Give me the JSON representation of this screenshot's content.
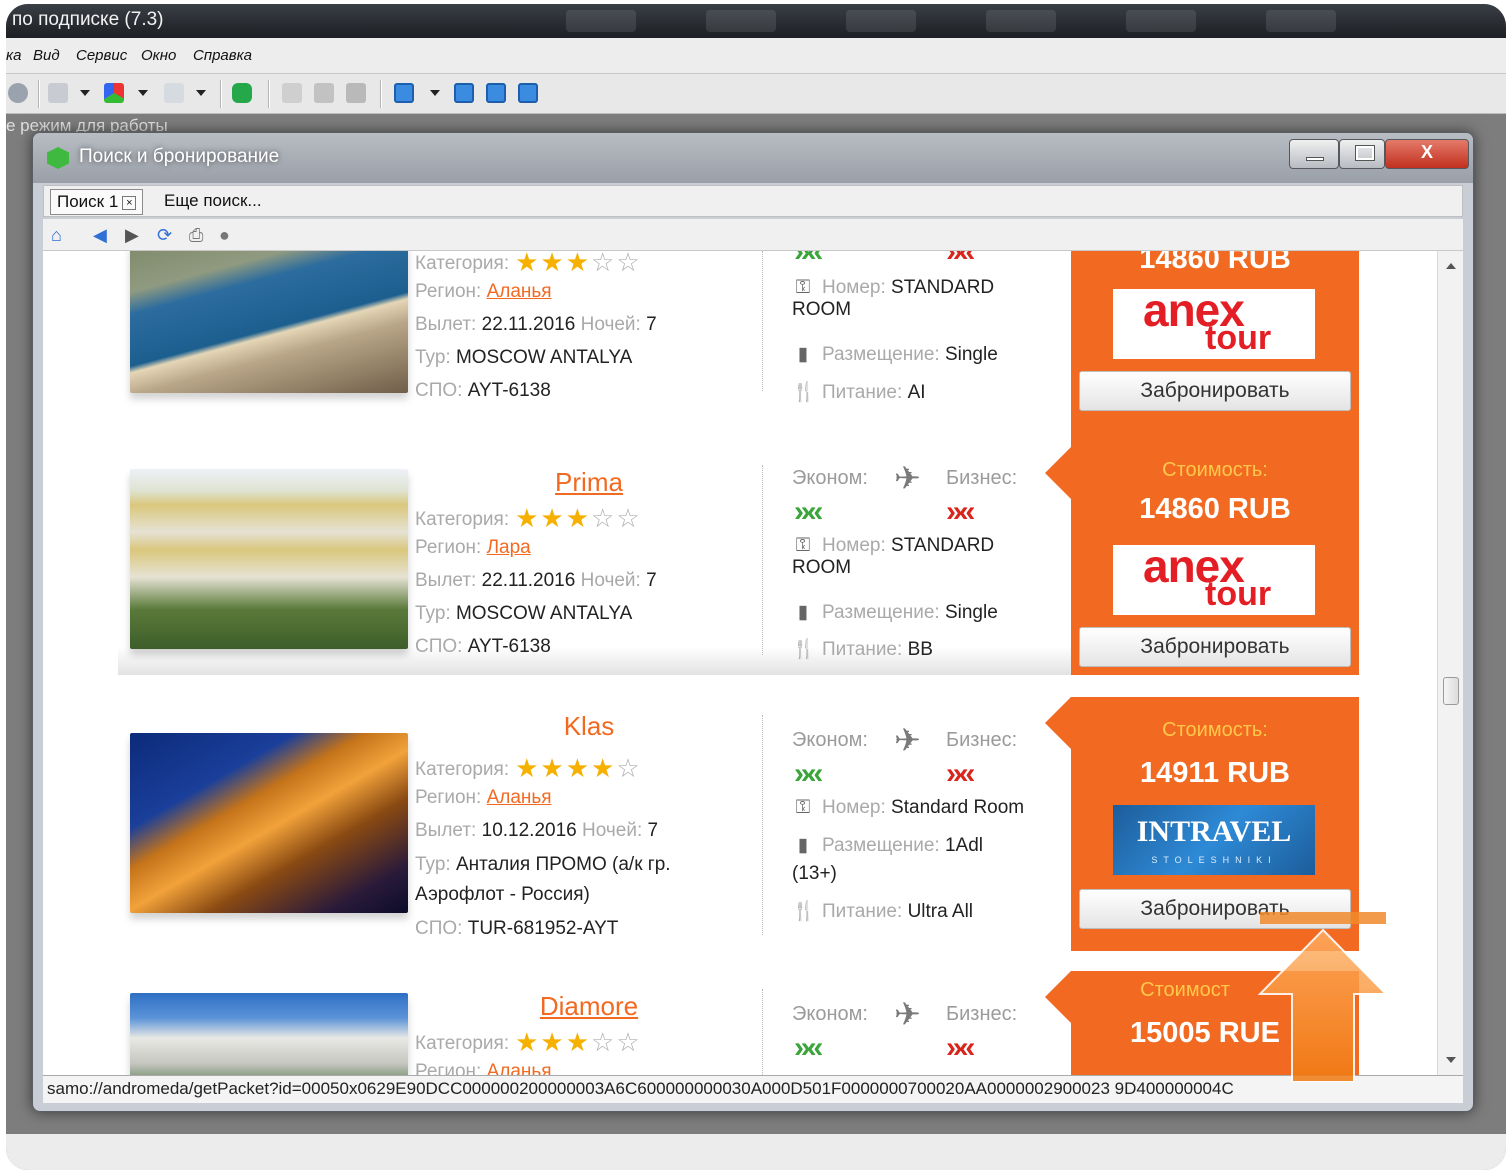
{
  "app": {
    "title_partial": "по подписке (7.3)",
    "menu": [
      "ка",
      "Вид",
      "Сервис",
      "Окно",
      "Справка"
    ],
    "status_partial": "е режим для работы"
  },
  "dialog": {
    "title": "Поиск и бронирование",
    "tabs": [
      {
        "label": "Поиск 1",
        "close": "×"
      },
      {
        "label": "Еще поиск..."
      }
    ],
    "window_buttons": {
      "minimize": "–",
      "maximize": "□",
      "close": "X"
    }
  },
  "labels": {
    "category": "Категория:",
    "region": "Регион:",
    "departure": "Вылет:",
    "nights": "Ночей:",
    "tour": "Тур:",
    "spo": "СПО:",
    "economy": "Эконом:",
    "business": "Бизнес:",
    "room": "Номер:",
    "placement": "Размещение:",
    "food": "Питание:",
    "cost": "Стоимость:",
    "book": "Забронировать"
  },
  "hotels": [
    {
      "name": "",
      "stars": 3,
      "region": "Аланья",
      "departure": "22.11.2016",
      "nights": "7",
      "tour": "MOSCOW ANTALYA",
      "spo": "AYT-6138",
      "room": "STANDARD ROOM",
      "placement": "Single",
      "food": "AI",
      "price": "14860 RUB",
      "operator": "anex"
    },
    {
      "name": "Prima",
      "stars": 3,
      "region": "Лара",
      "departure": "22.11.2016",
      "nights": "7",
      "tour": "MOSCOW ANTALYA",
      "spo": "AYT-6138",
      "room": "STANDARD ROOM",
      "placement": "Single",
      "food": "BB",
      "price": "14860 RUB",
      "operator": "anex"
    },
    {
      "name": "Klas",
      "stars": 4,
      "region": "Аланья",
      "departure": "10.12.2016",
      "nights": "7",
      "tour_line1": "Анталия ПРОМО (а/к гр.",
      "tour_line2": "Аэрофлот - Россия)",
      "spo": "TUR-681952-AYT",
      "room": "Standard Room",
      "placement_line1": "1Adl",
      "placement_line2": "(13+)",
      "food": "Ultra All",
      "price": "14911 RUB",
      "operator": "intravel"
    },
    {
      "name": "Diamore",
      "stars": 3,
      "region": "Аланья",
      "cost_partial": "Стоимост",
      "price": "15005 RUE"
    }
  ],
  "operators": {
    "anex": {
      "line1": "anex",
      "line2": "tour"
    },
    "intravel": {
      "line1": "INTRAVEL",
      "line2": "STOLESHNIKI"
    }
  },
  "status_url": "samo://andromeda/getPacket?id=00050x0629E90DCC000000200000003A6C600000000030A000D501F0000000700020AA0000002900023 9D400000004C",
  "colors": {
    "accent": "#f26a21",
    "economy": "#3aa63a",
    "business": "#d9261c",
    "star": "#f5b000"
  }
}
